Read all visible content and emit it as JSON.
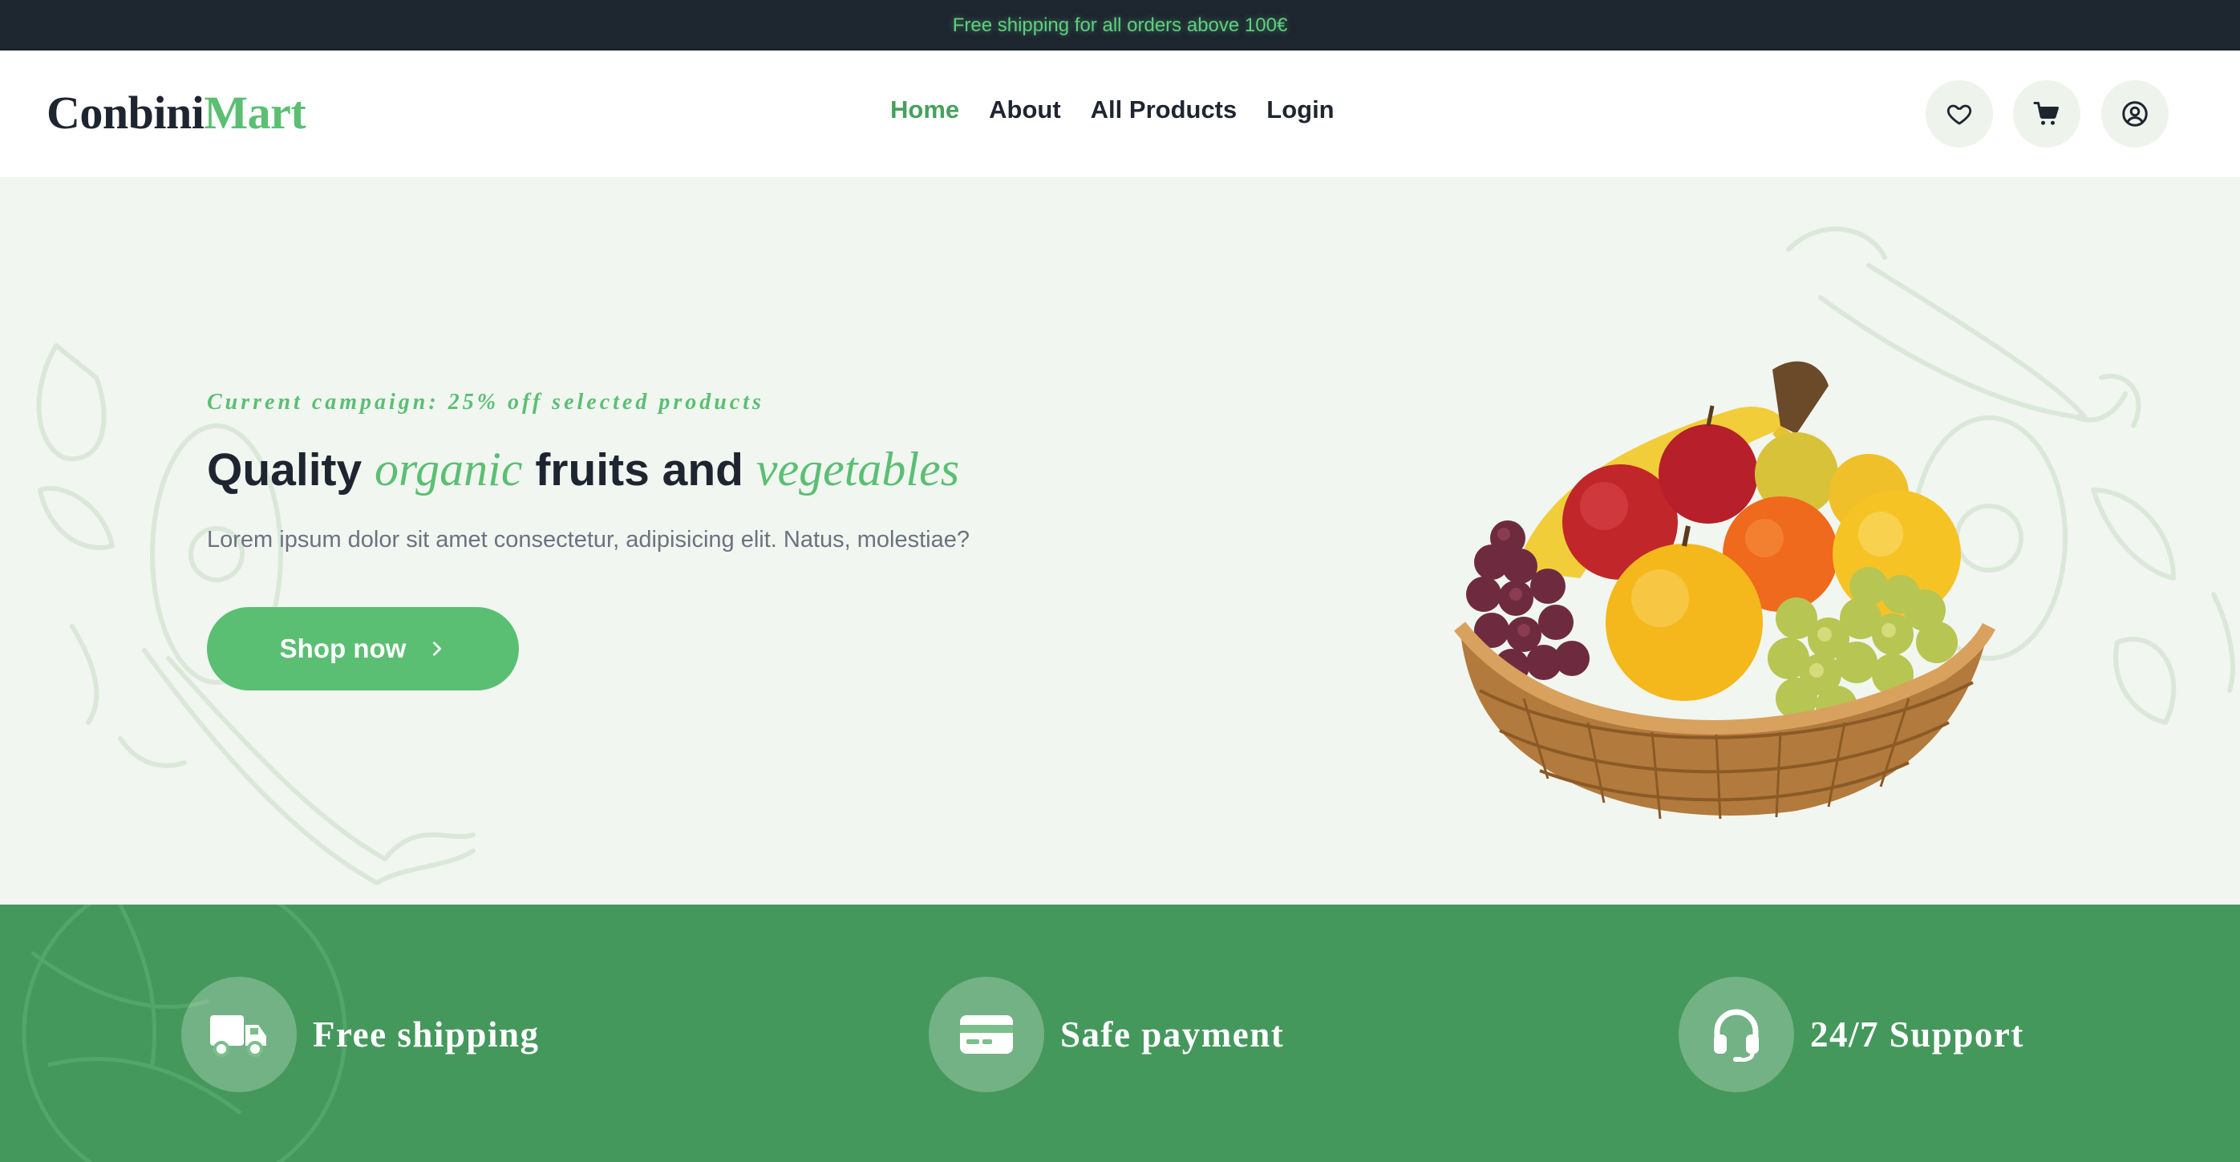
{
  "announcement": "Free shipping for all orders above 100€",
  "brand": {
    "part1": "Conbini",
    "part2": "Mart"
  },
  "nav": {
    "items": [
      {
        "label": "Home",
        "active": true
      },
      {
        "label": "About",
        "active": false
      },
      {
        "label": "All Products",
        "active": false
      },
      {
        "label": "Login",
        "active": false
      }
    ]
  },
  "header_icons": [
    "heart-icon",
    "cart-icon",
    "user-icon"
  ],
  "hero": {
    "campaign": "Current campaign: 25% off selected products",
    "headline": {
      "w1": "Quality ",
      "w2": "organic",
      "w3": " fruits and ",
      "w4": "vegetables"
    },
    "lead": "Lorem ipsum dolor sit amet consectetur, adipisicing elit. Natus, molestiae?",
    "cta": "Shop now",
    "cta_icon": "chevron-right-icon",
    "image": "fruit-basket"
  },
  "features": [
    {
      "icon": "truck-icon",
      "title": "Free shipping"
    },
    {
      "icon": "credit-card-icon",
      "title": "Safe payment"
    },
    {
      "icon": "headset-icon",
      "title": "24/7 Support"
    }
  ],
  "colors": {
    "accent": "#5bbf73",
    "accent_dark": "#48a05f",
    "band": "#45985c",
    "hero_bg": "#f1f6f0",
    "topbar_bg": "#1e2630",
    "text": "#1f2530",
    "muted": "#6b7280"
  }
}
